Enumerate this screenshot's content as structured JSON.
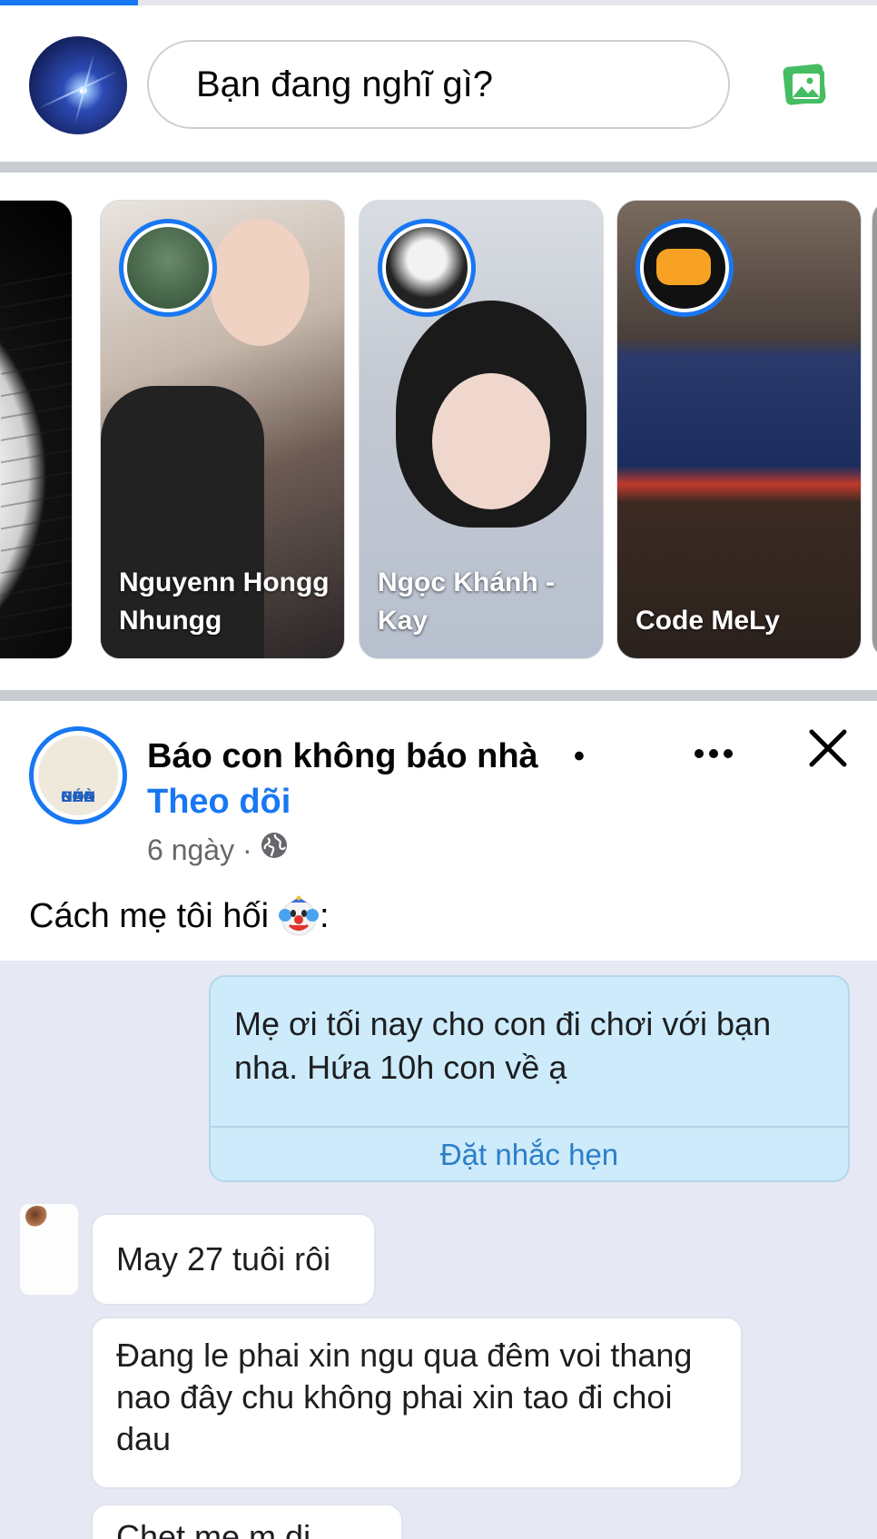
{
  "composer": {
    "placeholder": "Bạn đang nghĩ gì?"
  },
  "stories": [
    {
      "name": ""
    },
    {
      "name": "Nguyenn Hongg Nhungg"
    },
    {
      "name": "Ngọc Khánh - Kay"
    },
    {
      "name": "Code MeLy"
    }
  ],
  "post": {
    "page_name": "Báo con không báo nhà",
    "separator": "•",
    "follow_label": "Theo dõi",
    "time": "6 ngày ·",
    "text": "Cách mẹ tôi hối",
    "text_suffix": ":",
    "avatar_logo_text": [
      "CON",
      "BÁO",
      "NHÀ"
    ],
    "chat": {
      "outgoing_message": "Mẹ ơi tối nay cho con đi chơi với bạn nha. Hứa 10h con về ạ",
      "reminder_label": "Đặt nhắc hẹn",
      "incoming_messages": [
        "May 27 tuôi rôi",
        "Đang le phai xin ngu qua đêm voi thang nao đây chu không phai xin tao đi choi dau",
        "Chet me m di"
      ]
    }
  },
  "colors": {
    "accent": "#1877f2",
    "divider": "#c9ccd1",
    "chat_background": "#e6e9f4",
    "outgoing_bubble": "#cdebfa",
    "reminder_link": "#2c7fc7"
  },
  "icons": {
    "photo": "photo-icon",
    "more": "more-dots-icon",
    "close": "close-icon",
    "globe": "globe-icon",
    "emoji": "clown-face-emoji"
  }
}
